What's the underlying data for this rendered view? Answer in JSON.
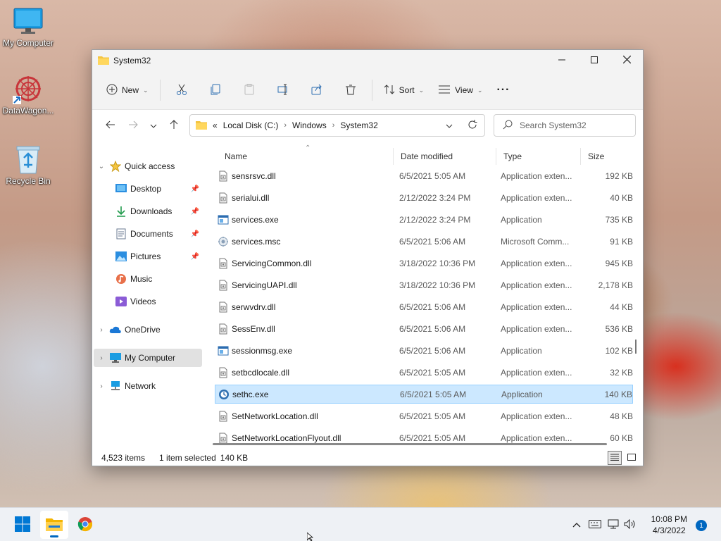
{
  "desktop": {
    "icons": [
      {
        "label": "My Computer",
        "icon": "monitor-icon"
      },
      {
        "label": "DataWagon...",
        "icon": "datawagon-icon"
      },
      {
        "label": "Recycle Bin",
        "icon": "recycle-bin-icon"
      }
    ]
  },
  "window": {
    "title": "System32",
    "toolbar": {
      "new_label": "New",
      "sort_label": "Sort",
      "view_label": "View",
      "more_label": "···"
    },
    "address": {
      "overflow": "«",
      "crumbs": [
        "Local Disk (C:)",
        "Windows",
        "System32"
      ]
    },
    "search_placeholder": "Search System32",
    "nav": {
      "quick_access": "Quick access",
      "desktop": "Desktop",
      "downloads": "Downloads",
      "documents": "Documents",
      "pictures": "Pictures",
      "music": "Music",
      "videos": "Videos",
      "onedrive": "OneDrive",
      "my_computer": "My Computer",
      "network": "Network"
    },
    "columns": {
      "name": "Name",
      "date": "Date modified",
      "type": "Type",
      "size": "Size"
    },
    "files": [
      {
        "name": "sensrsvc.dll",
        "date": "6/5/2021 5:05 AM",
        "type": "Application exten...",
        "size": "192 KB",
        "icon": "dll"
      },
      {
        "name": "serialui.dll",
        "date": "2/12/2022 3:24 PM",
        "type": "Application exten...",
        "size": "40 KB",
        "icon": "dll"
      },
      {
        "name": "services.exe",
        "date": "2/12/2022 3:24 PM",
        "type": "Application",
        "size": "735 KB",
        "icon": "exe"
      },
      {
        "name": "services.msc",
        "date": "6/5/2021 5:06 AM",
        "type": "Microsoft Comm...",
        "size": "91 KB",
        "icon": "msc"
      },
      {
        "name": "ServicingCommon.dll",
        "date": "3/18/2022 10:36 PM",
        "type": "Application exten...",
        "size": "945 KB",
        "icon": "dll"
      },
      {
        "name": "ServicingUAPI.dll",
        "date": "3/18/2022 10:36 PM",
        "type": "Application exten...",
        "size": "2,178 KB",
        "icon": "dll"
      },
      {
        "name": "serwvdrv.dll",
        "date": "6/5/2021 5:06 AM",
        "type": "Application exten...",
        "size": "44 KB",
        "icon": "dll"
      },
      {
        "name": "SessEnv.dll",
        "date": "6/5/2021 5:06 AM",
        "type": "Application exten...",
        "size": "536 KB",
        "icon": "dll"
      },
      {
        "name": "sessionmsg.exe",
        "date": "6/5/2021 5:06 AM",
        "type": "Application",
        "size": "102 KB",
        "icon": "exe"
      },
      {
        "name": "setbcdlocale.dll",
        "date": "6/5/2021 5:05 AM",
        "type": "Application exten...",
        "size": "32 KB",
        "icon": "dll"
      },
      {
        "name": "sethc.exe",
        "date": "6/5/2021 5:05 AM",
        "type": "Application",
        "size": "140 KB",
        "icon": "sethc",
        "selected": true
      },
      {
        "name": "SetNetworkLocation.dll",
        "date": "6/5/2021 5:05 AM",
        "type": "Application exten...",
        "size": "48 KB",
        "icon": "dll"
      },
      {
        "name": "SetNetworkLocationFlyout.dll",
        "date": "6/5/2021 5:05 AM",
        "type": "Application exten...",
        "size": "60 KB",
        "icon": "dll"
      }
    ],
    "status": {
      "count": "4,523 items",
      "selected": "1 item selected",
      "selected_size": "140 KB"
    }
  },
  "taskbar": {
    "time": "10:08 PM",
    "date": "4/3/2022",
    "notifications": "1"
  },
  "colors": {
    "accent": "#0067c0",
    "selection": "#cce8ff",
    "folder": "#f4c542"
  }
}
